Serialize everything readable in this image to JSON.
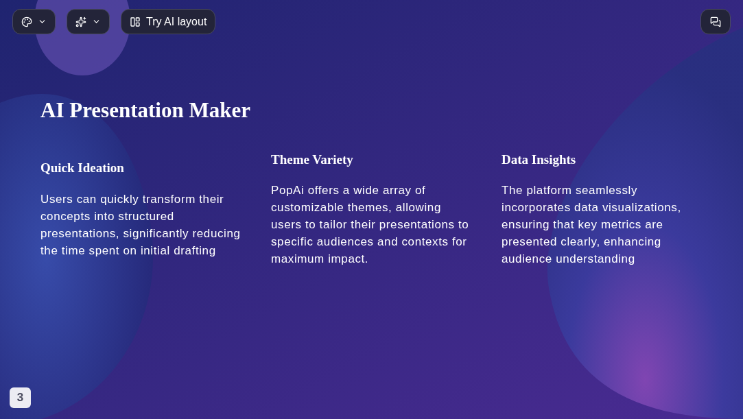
{
  "toolbar": {
    "ai_layout_button": "Try AI layout"
  },
  "slide": {
    "title": "AI Presentation Maker",
    "columns": [
      {
        "heading": "Quick Ideation",
        "body": "Users can quickly transform their concepts into structured presentations, significantly reducing the time spent on initial drafting"
      },
      {
        "heading": "Theme Variety",
        "body": "PopAi offers a wide array of customizable themes, allowing users to tailor their presentations to specific audiences and contexts for maximum impact."
      },
      {
        "heading": "Data Insights",
        "body": "The platform seamlessly incorporates data visualizations, ensuring that key metrics are presented clearly, enhancing audience understanding"
      }
    ]
  },
  "page_number": "3"
}
